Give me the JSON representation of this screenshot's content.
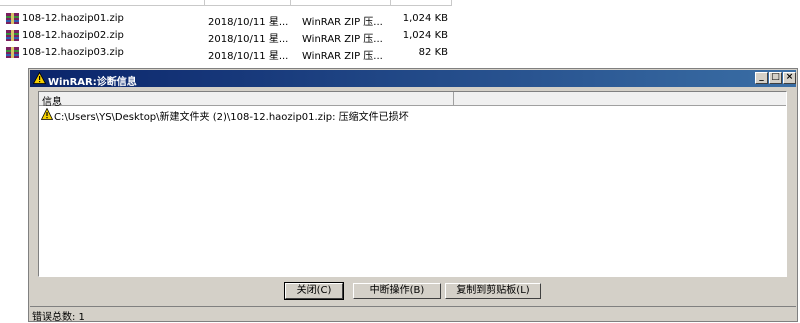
{
  "explorer": {
    "files": [
      {
        "name": "108-12.haozip01.zip",
        "date": "2018/10/11 星...",
        "type": "WinRAR ZIP 压...",
        "size": "1,024 KB"
      },
      {
        "name": "108-12.haozip02.zip",
        "date": "2018/10/11 星...",
        "type": "WinRAR ZIP 压...",
        "size": "1,024 KB"
      },
      {
        "name": "108-12.haozip03.zip",
        "date": "2018/10/11 星...",
        "type": "WinRAR ZIP 压...",
        "size": "82 KB"
      }
    ]
  },
  "dialog": {
    "title": "WinRAR:诊断信息",
    "column_header": "信息",
    "messages": [
      {
        "icon": "warning-icon",
        "text": "C:\\Users\\YS\\Desktop\\新建文件夹 (2)\\108-12.haozip01.zip: 压缩文件已损坏"
      }
    ],
    "buttons": {
      "close": "关闭(C)",
      "abort": "中断操作(B)",
      "copy": "复制到剪贴板(L)"
    },
    "status": "错误总数: 1"
  },
  "colors": {
    "title_start": "#0a246a",
    "title_end": "#3a6ea5",
    "dialog_bg": "#d4d0c8"
  }
}
